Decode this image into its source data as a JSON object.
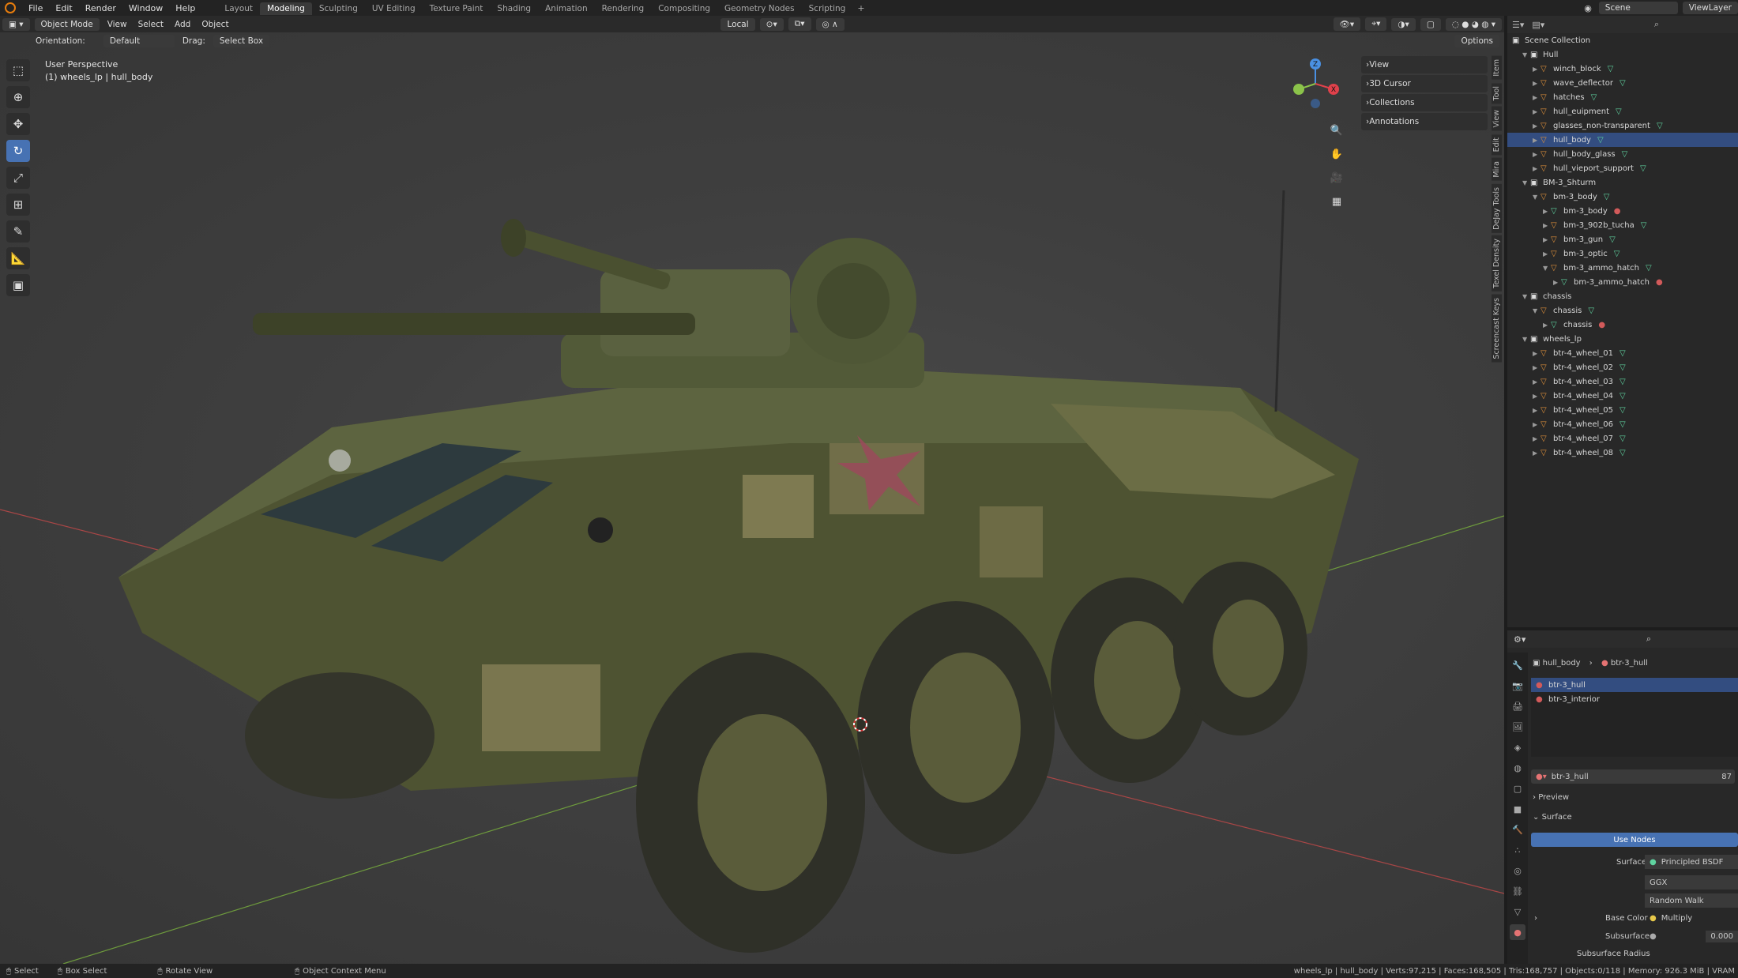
{
  "topbar": {
    "menu": [
      "File",
      "Edit",
      "Render",
      "Window",
      "Help"
    ],
    "workspaces": [
      "Layout",
      "Modeling",
      "Sculpting",
      "UV Editing",
      "Texture Paint",
      "Shading",
      "Animation",
      "Rendering",
      "Compositing",
      "Geometry Nodes",
      "Scripting"
    ],
    "add_tab": "+",
    "scene_label": "Scene",
    "viewlayer_label": "ViewLayer"
  },
  "header": {
    "mode": "Object Mode",
    "menus": [
      "View",
      "Select",
      "Add",
      "Object"
    ],
    "transform_orientation": "Local"
  },
  "tool_settings": {
    "orientation_label": "Orientation:",
    "orientation_value": "Default",
    "drag_label": "Drag:",
    "drag_value": "Select Box",
    "options_label": "Options"
  },
  "viewport": {
    "perspective": "User Perspective",
    "active_object": "(1) wheels_lp | hull_body",
    "npanel_sections": [
      "View",
      "3D Cursor",
      "Collections",
      "Annotations"
    ],
    "sidebar_tabs": [
      "Item",
      "Tool",
      "View",
      "Edit",
      "Mira",
      "DeJay Tools",
      "Texel Density",
      "Screencast Keys"
    ],
    "gizmo_axes": {
      "x": "X",
      "y": "Y",
      "z": "Z"
    }
  },
  "outliner": {
    "root": "Scene Collection",
    "rows": [
      {
        "depth": 1,
        "kind": "coll",
        "name": "Hull",
        "expanded": true
      },
      {
        "depth": 2,
        "kind": "obj",
        "name": "winch_block"
      },
      {
        "depth": 2,
        "kind": "obj",
        "name": "wave_deflector"
      },
      {
        "depth": 2,
        "kind": "obj",
        "name": "hatches"
      },
      {
        "depth": 2,
        "kind": "obj",
        "name": "hull_euipment"
      },
      {
        "depth": 2,
        "kind": "obj",
        "name": "glasses_non-transparent"
      },
      {
        "depth": 2,
        "kind": "obj",
        "name": "hull_body",
        "selected": true
      },
      {
        "depth": 2,
        "kind": "obj",
        "name": "hull_body_glass"
      },
      {
        "depth": 2,
        "kind": "obj",
        "name": "hull_vieport_support"
      },
      {
        "depth": 1,
        "kind": "coll",
        "name": "BM-3_Shturm",
        "expanded": true
      },
      {
        "depth": 2,
        "kind": "obj",
        "name": "bm-3_body",
        "expanded": true
      },
      {
        "depth": 3,
        "kind": "mesh",
        "name": "bm-3_body"
      },
      {
        "depth": 3,
        "kind": "obj",
        "name": "bm-3_902b_tucha"
      },
      {
        "depth": 3,
        "kind": "obj",
        "name": "bm-3_gun"
      },
      {
        "depth": 3,
        "kind": "obj",
        "name": "bm-3_optic"
      },
      {
        "depth": 3,
        "kind": "obj",
        "name": "bm-3_ammo_hatch",
        "expanded": true
      },
      {
        "depth": 4,
        "kind": "mesh",
        "name": "bm-3_ammo_hatch"
      },
      {
        "depth": 1,
        "kind": "coll",
        "name": "chassis",
        "expanded": true
      },
      {
        "depth": 2,
        "kind": "obj",
        "name": "chassis",
        "expanded": true
      },
      {
        "depth": 3,
        "kind": "mesh",
        "name": "chassis"
      },
      {
        "depth": 1,
        "kind": "coll",
        "name": "wheels_lp",
        "expanded": true
      },
      {
        "depth": 2,
        "kind": "obj",
        "name": "btr-4_wheel_01"
      },
      {
        "depth": 2,
        "kind": "obj",
        "name": "btr-4_wheel_02"
      },
      {
        "depth": 2,
        "kind": "obj",
        "name": "btr-4_wheel_03"
      },
      {
        "depth": 2,
        "kind": "obj",
        "name": "btr-4_wheel_04"
      },
      {
        "depth": 2,
        "kind": "obj",
        "name": "btr-4_wheel_05"
      },
      {
        "depth": 2,
        "kind": "obj",
        "name": "btr-4_wheel_06"
      },
      {
        "depth": 2,
        "kind": "obj",
        "name": "btr-4_wheel_07"
      },
      {
        "depth": 2,
        "kind": "obj",
        "name": "btr-4_wheel_08"
      }
    ]
  },
  "properties": {
    "breadcrumb_object": "hull_body",
    "breadcrumb_material": "btr-3_hull",
    "material_slots": [
      "btr-3_hull",
      "btr-3_interior"
    ],
    "material_name": "btr-3_hull",
    "user_count": "87",
    "preview_label": "Preview",
    "surface_panel": "Surface",
    "use_nodes_label": "Use Nodes",
    "surface_label": "Surface",
    "surface_value": "Principled BSDF",
    "distribution": "GGX",
    "subsurface_method": "Random Walk",
    "base_color_label": "Base Color",
    "base_color_value": "Multiply",
    "subsurface_label": "Subsurface",
    "subsurface_value": "0.000",
    "subsurface_radius_label": "Subsurface Radius"
  },
  "statusbar": {
    "select": "Select",
    "box_select": "Box Select",
    "rotate_view": "Rotate View",
    "context_menu": "Object Context Menu",
    "stats": "wheels_lp | hull_body | Verts:97,215 | Faces:168,505 | Tris:168,757 | Objects:0/118 | Memory: 926.3 MiB | VRAM"
  },
  "colors": {
    "accent": "#4772b3",
    "selected_row": "#334d80",
    "object_icon": "#e0913a",
    "mesh_icon": "#5fd3a0",
    "material_icon": "#d25a5a",
    "axis_x": "#e0414b",
    "axis_y": "#8bc34a",
    "axis_z": "#4a90e2"
  }
}
